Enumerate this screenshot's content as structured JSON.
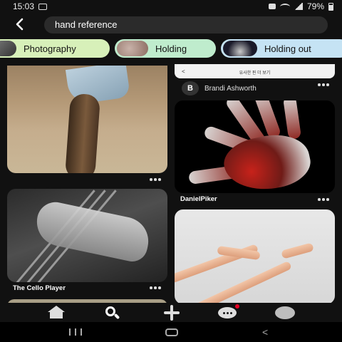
{
  "status_bar": {
    "time": "15:03",
    "battery": "79%",
    "icons": [
      "photo-icon",
      "camera-icon",
      "wifi-icon",
      "signal-icon",
      "battery-icon"
    ]
  },
  "search": {
    "query": "hand reference",
    "back_icon": "back-arrow-icon"
  },
  "chips": [
    {
      "label": "Photography",
      "color": "#d7f0b9"
    },
    {
      "label": "Holding",
      "color": "#bfeccd"
    },
    {
      "label": "Holding out",
      "color": "#c5e3f4"
    }
  ],
  "pins": {
    "cello_title": "The Cello Player",
    "ad_text": "유사한 핀 더 보기",
    "ad_back": "<",
    "byline_initial": "B",
    "byline_name": "Brandi Ashworth",
    "red_hand_author": "DanielPiker"
  },
  "bottom_nav": {
    "items": [
      "home-icon",
      "search-icon",
      "create-icon",
      "messages-icon",
      "profile-icon"
    ],
    "active": "search",
    "badge_color": "#e60023"
  },
  "system_nav": {
    "back_glyph": "<"
  }
}
